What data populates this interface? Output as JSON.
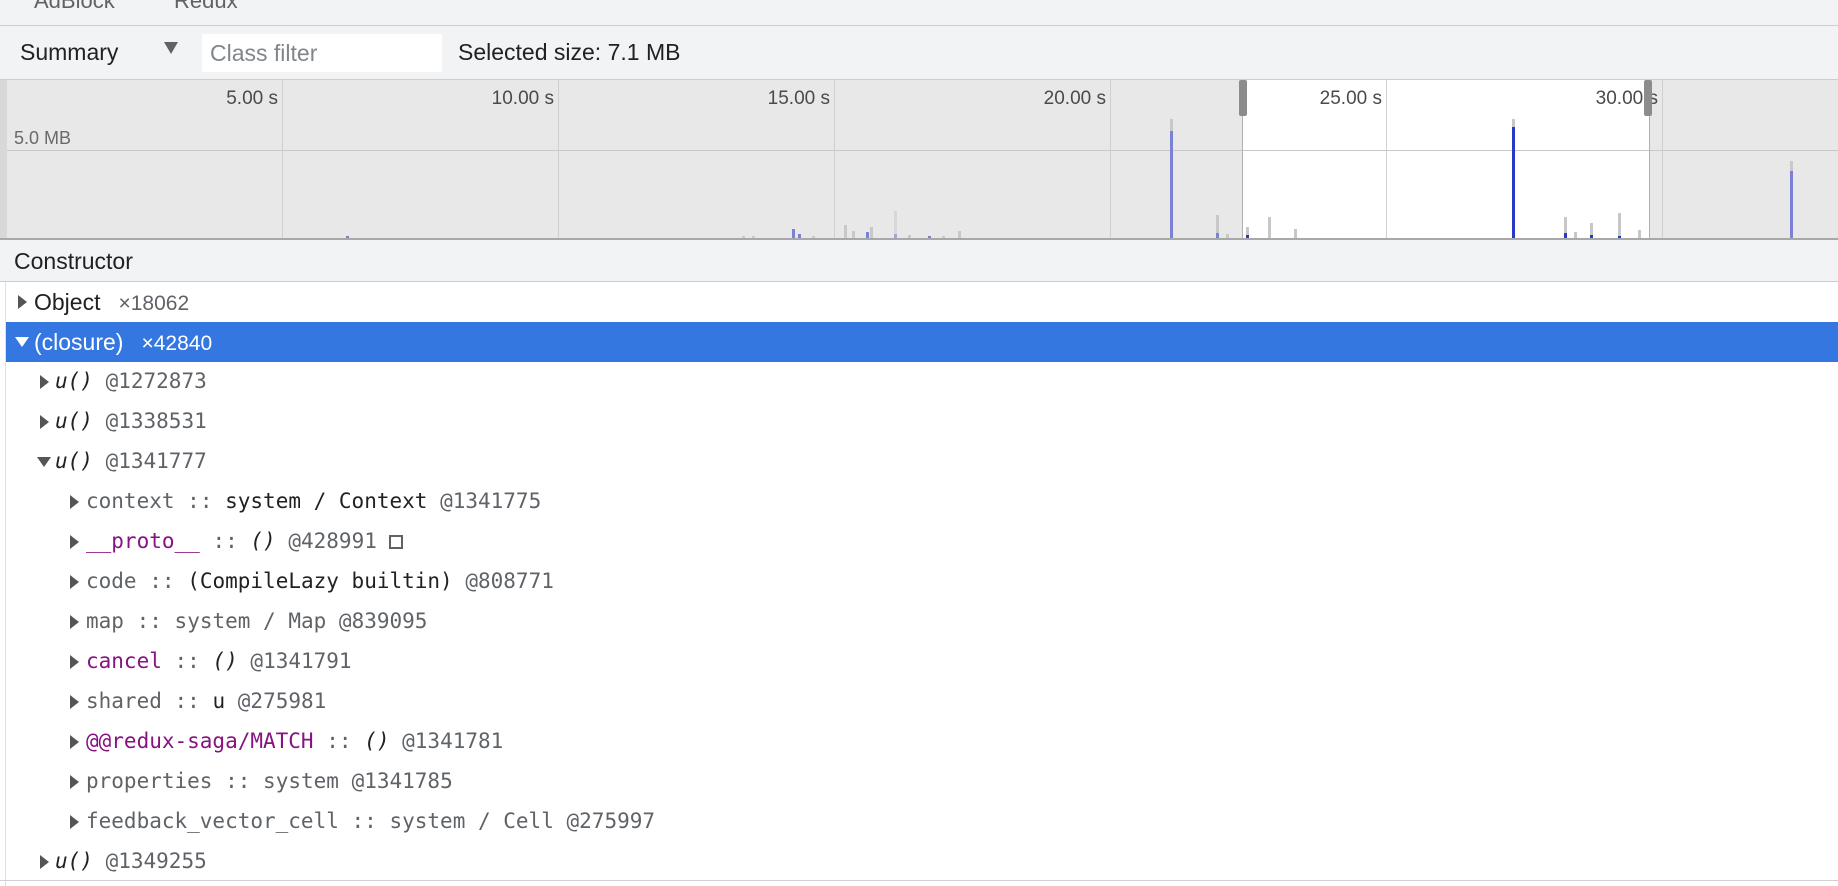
{
  "tabs": [
    "AdBlock",
    "Redux"
  ],
  "toolbar": {
    "view_selected": "Summary",
    "class_filter_placeholder": "Class filter",
    "selected_size": "Selected size: 7.1 MB"
  },
  "timeline": {
    "ticks": [
      "5.00 s",
      "10.00 s",
      "15.00 s",
      "20.00 s",
      "25.00 s",
      "30.00 s"
    ],
    "memory_label": "5.0 MB"
  },
  "table": {
    "header": "Constructor",
    "rows": [
      {
        "name": "Object",
        "count": "×18062"
      },
      {
        "name": "(closure)",
        "count": "×42840"
      }
    ],
    "children": [
      {
        "fn": "u()",
        "id": "@1272873"
      },
      {
        "fn": "u()",
        "id": "@1338531"
      },
      {
        "fn": "u()",
        "id": "@1341777"
      },
      {
        "fn": "u()",
        "id": "@1349255"
      }
    ],
    "retainers": [
      {
        "edge": "context",
        "sep": "::",
        "type": "system / Context",
        "id": "@1341775"
      },
      {
        "edge": "__proto__",
        "sep": "::",
        "type": "()",
        "id": "@428991"
      },
      {
        "edge": "code",
        "sep": "::",
        "type": "(CompileLazy builtin)",
        "id": "@808771"
      },
      {
        "edge": "map",
        "sep": "::",
        "type": "system / Map",
        "id": "@839095"
      },
      {
        "edge": "cancel",
        "sep": "::",
        "type": "()",
        "id": "@1341791"
      },
      {
        "edge": "shared",
        "sep": "::",
        "type": "u",
        "id": "@275981"
      },
      {
        "edge": "@@redux-saga/MATCH",
        "sep": "::",
        "type": "()",
        "id": "@1341781"
      },
      {
        "edge": "properties",
        "sep": "::",
        "type": "system",
        "id": "@1341785"
      },
      {
        "edge": "feedback_vector_cell",
        "sep": "::",
        "type": "system / Cell",
        "id": "@275997"
      }
    ]
  },
  "colors": {
    "selection_bg": "#3477e0",
    "allocation_bar": "#2a39c4",
    "purple_property": "#881280"
  }
}
